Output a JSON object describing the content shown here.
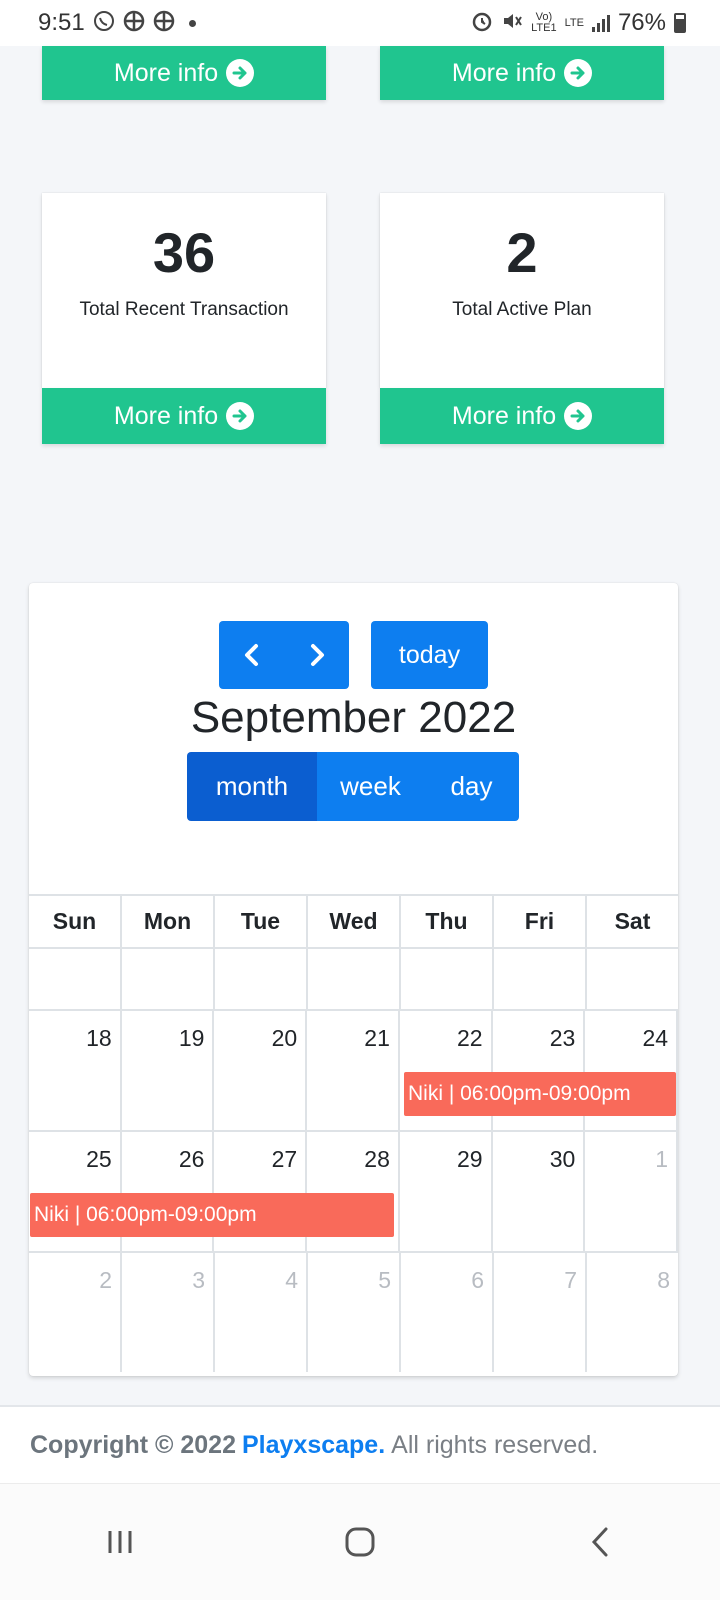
{
  "status_bar": {
    "time": "9:51",
    "network": "LTE",
    "battery": "76%"
  },
  "more_info_label": "More info",
  "boxes": [
    {
      "value": "36",
      "label": "Total Recent Transaction"
    },
    {
      "value": "2",
      "label": "Total Active Plan"
    }
  ],
  "calendar": {
    "prev_icon": "chevron-left-icon",
    "next_icon": "chevron-right-icon",
    "today_label": "today",
    "title": "September 2022",
    "views": [
      "month",
      "week",
      "day"
    ],
    "active_view": "month",
    "weekdays": [
      "Sun",
      "Mon",
      "Tue",
      "Wed",
      "Thu",
      "Fri",
      "Sat"
    ],
    "weeks": [
      [
        "",
        "",
        "",
        "",
        "",
        "",
        ""
      ],
      [
        "18",
        "19",
        "20",
        "21",
        "22",
        "23",
        "24"
      ],
      [
        "25",
        "26",
        "27",
        "28",
        "29",
        "30",
        "1"
      ],
      [
        "2",
        "3",
        "4",
        "5",
        "6",
        "7",
        "8"
      ]
    ],
    "events": [
      {
        "title": "Niki | 06:00pm-09:00pm",
        "start": "2022-09-22",
        "end": "2022-09-24"
      },
      {
        "title": "Niki | 06:00pm-09:00pm",
        "start": "2022-09-25",
        "end": "2022-09-28"
      }
    ],
    "event_color": "#f96a5a"
  },
  "footer": {
    "copyright": "Copyright © 2022",
    "brand": "Playxscape.",
    "rest": "All rights reserved."
  },
  "colors": {
    "accent": "#20c58f",
    "primary": "#0d7ef0",
    "primary_active": "#0b5ed0"
  }
}
